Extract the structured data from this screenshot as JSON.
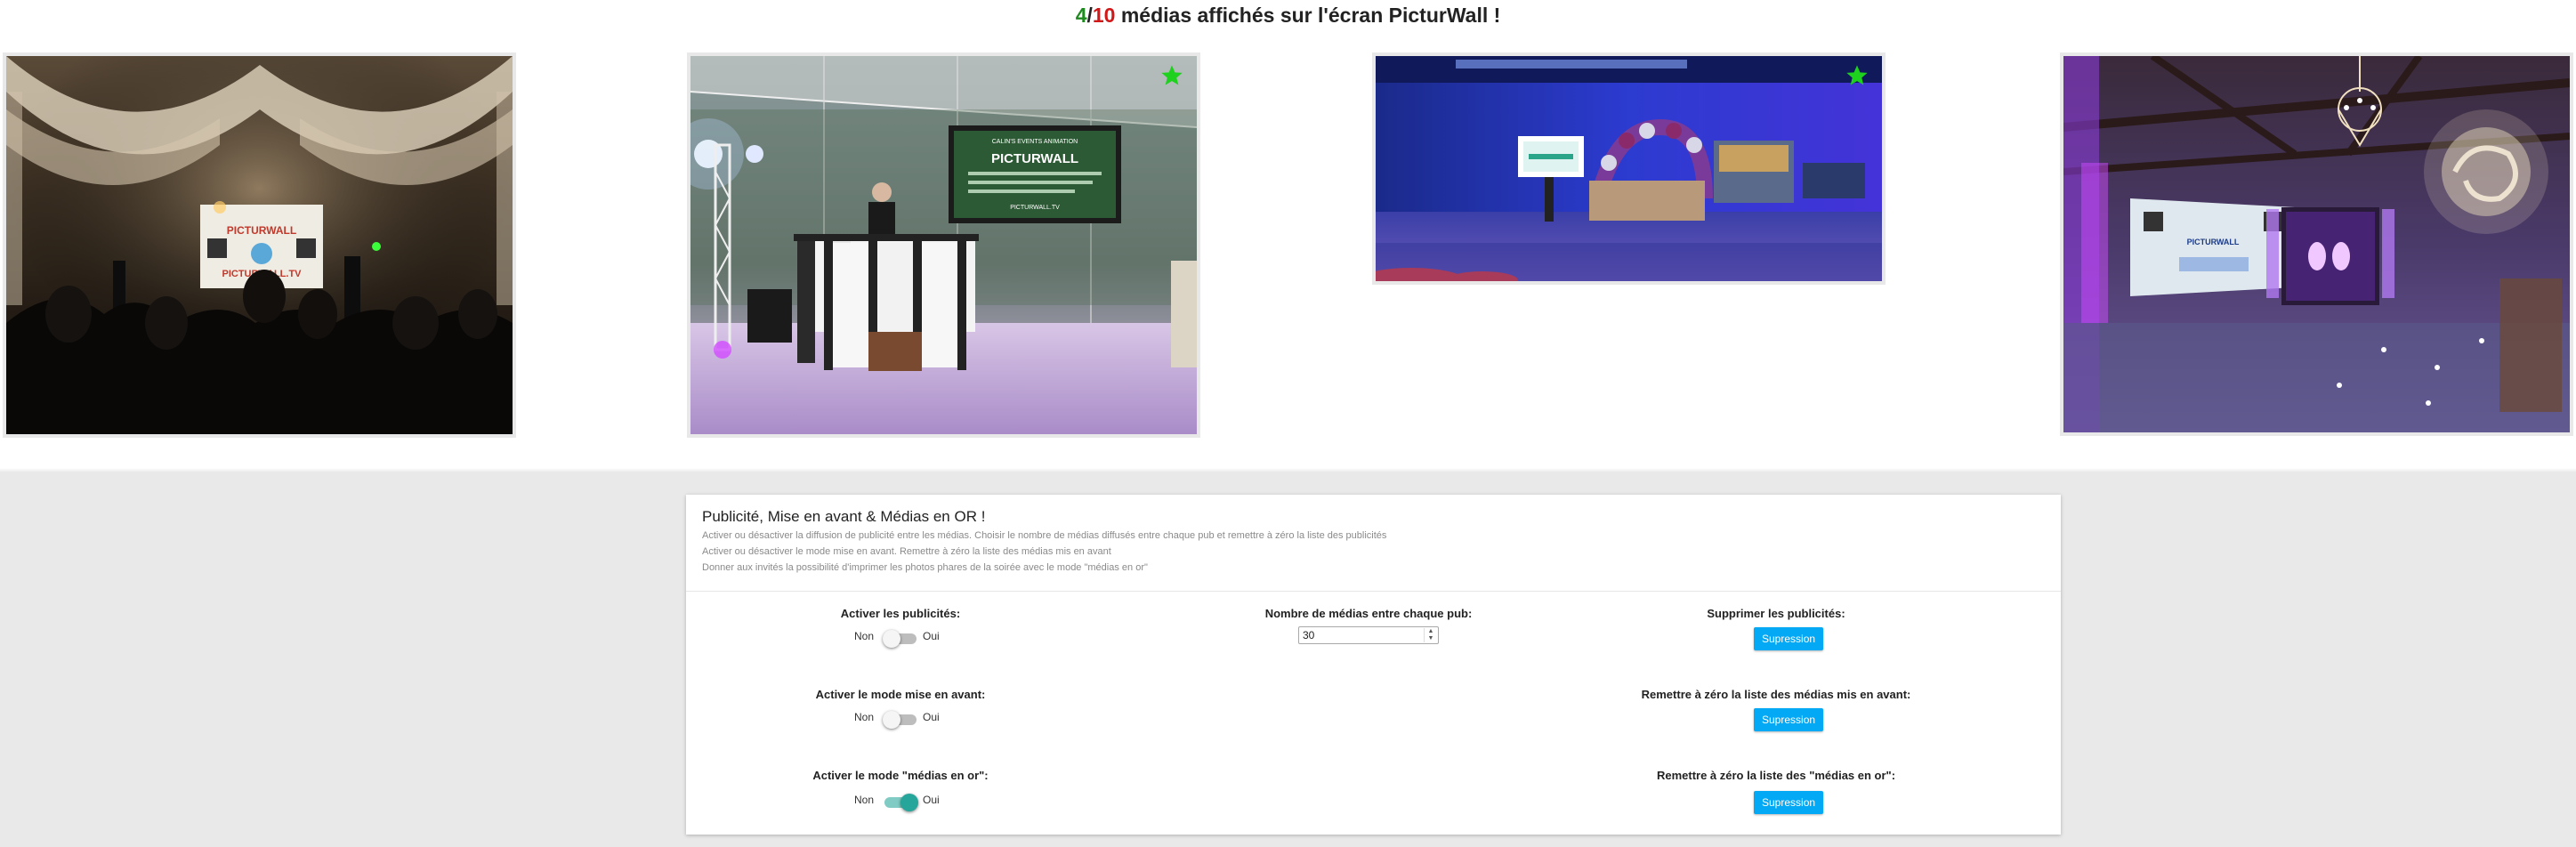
{
  "header": {
    "shown_count": "4",
    "separator": "/",
    "total_count": "10",
    "suffix": " médias affichés sur l'écran PicturWall !",
    "colors": {
      "shown": "#1f8a1f",
      "total": "#d01818"
    }
  },
  "photos": [
    {
      "name": "photo-1",
      "starred": false,
      "icon": "none"
    },
    {
      "name": "photo-2",
      "starred": true,
      "icon": "star-icon"
    },
    {
      "name": "photo-3",
      "starred": true,
      "icon": "star-icon"
    },
    {
      "name": "photo-4",
      "starred": false,
      "icon": "none"
    }
  ],
  "photo_texts": {
    "screen_brand": "PICTURWALL",
    "screen_url": "PICTURWALL.TV",
    "screen_subtitle": "CALIN'S EVENTS ANIMATION"
  },
  "panel": {
    "title": "Publicité, Mise en avant & Médias en OR !",
    "lines": [
      "Activer ou désactiver la diffusion de publicité entre les médias. Choisir le nombre de médias diffusés entre chaque pub et remettre à zéro la liste des publicités",
      "Activer ou désactiver le mode mise en avant. Remettre à zéro la liste des médias mis en avant",
      "Donner aux invités la possibilité d'imprimer les photos phares de la soirée avec le mode \"médias en or\""
    ]
  },
  "settings": {
    "ads": {
      "label": "Activer les publicités:",
      "off": "Non",
      "on": "Oui",
      "enabled": false
    },
    "highlight": {
      "label": "Activer le mode mise en avant:",
      "off": "Non",
      "on": "Oui",
      "enabled": false
    },
    "gold": {
      "label": "Activer le mode \"médias en or\":",
      "off": "Non",
      "on": "Oui",
      "enabled": true
    },
    "media_between_ads": {
      "label": "Nombre de médias entre chaque pub:",
      "value": "30"
    },
    "delete_ads": {
      "label": "Supprimer les publicités:",
      "button": "Supression"
    },
    "reset_highlight": {
      "label": "Remettre à zéro la liste des médias mis en avant:",
      "button": "Supression"
    },
    "reset_gold": {
      "label": "Remettre à zéro la liste des \"médias en or\":",
      "button": "Supression"
    }
  },
  "colors": {
    "accent_button": "#03a9f4",
    "switch_on": "#26a69a",
    "star": "#1fd11f",
    "background_gray": "#e9e9e9"
  }
}
